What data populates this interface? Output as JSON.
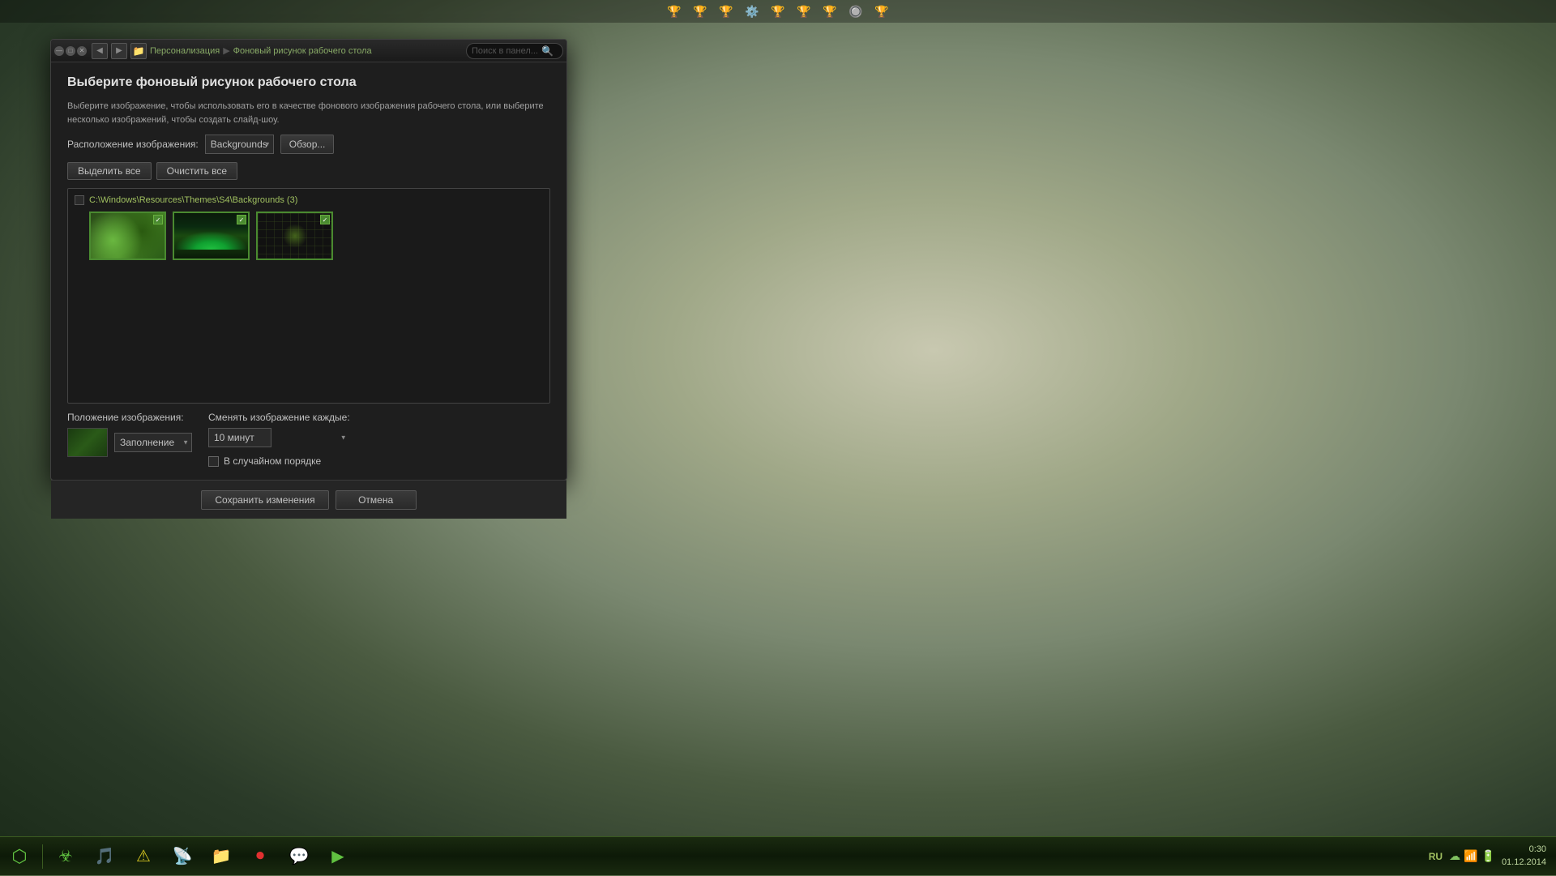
{
  "desktop": {
    "bg_color": "#5a6b4a"
  },
  "top_toolbar": {
    "icons": [
      "🏆",
      "🏆",
      "🏆",
      "⚙️",
      "🏆",
      "🏆",
      "🏆",
      "🔘",
      "🏆"
    ]
  },
  "dialog": {
    "title": "Выберите фоновый рисунок рабочего стола",
    "description": "Выберите изображение, чтобы использовать его в качестве фонового изображения рабочего стола, или выберите несколько изображений, чтобы создать слайд-шоу.",
    "breadcrumb_personalize": "Персонализация",
    "breadcrumb_sep": "▶",
    "breadcrumb_wallpaper": "Фоновый рисунок рабочего стола",
    "search_placeholder": "Поиск в панел...",
    "image_location_label": "Расположение изображения:",
    "location_value": "Backgrounds",
    "browse_label": "Обзор...",
    "select_all_label": "Выделить все",
    "clear_all_label": "Очистить все",
    "folder_path": "C:\\Windows\\Resources\\Themes\\S4\\Backgrounds (3)",
    "thumbnails": [
      {
        "id": 1,
        "selected": true,
        "style": "nature-green"
      },
      {
        "id": 2,
        "selected": true,
        "style": "aurora"
      },
      {
        "id": 3,
        "selected": true,
        "style": "tech-grid"
      }
    ],
    "position_label": "Положение изображения:",
    "position_value": "Заполнение",
    "change_every_label": "Сменять изображение каждые:",
    "change_interval": "10 минут",
    "random_label": "В случайном порядке",
    "save_label": "Сохранить изменения",
    "cancel_label": "Отмена",
    "titlebar_buttons": {
      "minimize": "—",
      "maximize": "□",
      "close": "✕"
    }
  },
  "taskbar": {
    "start_icon": "⬡",
    "icons": [
      {
        "name": "virus-shield",
        "symbol": "☣",
        "color": "#60c040"
      },
      {
        "name": "media",
        "symbol": "🎵",
        "color": "#d0a030"
      },
      {
        "name": "warning",
        "symbol": "⚠",
        "color": "#d0c020"
      },
      {
        "name": "network",
        "symbol": "📡",
        "color": "#4080e0"
      },
      {
        "name": "folder",
        "symbol": "📁",
        "color": "#e08020"
      },
      {
        "name": "record",
        "symbol": "⏺",
        "color": "#e03030"
      },
      {
        "name": "chat",
        "symbol": "💬",
        "color": "#80c0e0"
      },
      {
        "name": "app",
        "symbol": "▶",
        "color": "#60c040"
      }
    ],
    "lang": "RU",
    "clock": "0:30",
    "date": "01.12.2014",
    "signal_icons": [
      "☁",
      "📶",
      "🔋"
    ]
  }
}
